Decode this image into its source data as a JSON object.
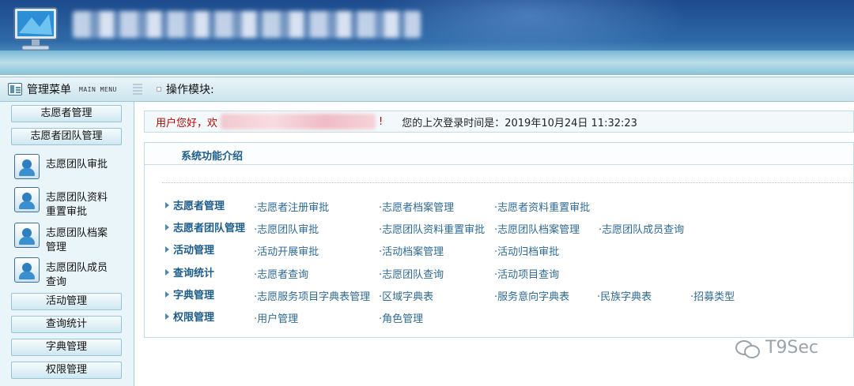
{
  "nav": {
    "menu_label": "管理菜单",
    "menu_sub": "MAIN MENU",
    "ops_label": "操作模块:"
  },
  "sidebar": {
    "categories": [
      "志愿者管理",
      "志愿者团队管理",
      "活动管理",
      "查询统计",
      "字典管理",
      "权限管理"
    ],
    "sub_items": [
      "志愿团队审批",
      "志愿团队资料重置审批",
      "志愿团队档案管理",
      "志愿团队成员查询"
    ]
  },
  "greeting": {
    "text": "用户您好，欢",
    "bang": "!",
    "last_login": "您的上次登录时间是：2019年10月24日 11:32:23"
  },
  "panel": {
    "title": "系统功能介绍",
    "rows": [
      {
        "head": "志愿者管理",
        "links": [
          "·志愿者注册审批",
          "·志愿者档案管理",
          "·志愿者资料重置审批"
        ]
      },
      {
        "head": "志愿者团队管理",
        "links": [
          "·志愿团队审批",
          "·志愿团队资料重置审批",
          "·志愿团队档案管理",
          "·志愿团队成员查询"
        ]
      },
      {
        "head": "活动管理",
        "links": [
          "·活动开展审批",
          "·活动档案管理",
          "·活动归档审批"
        ]
      },
      {
        "head": "查询统计",
        "links": [
          "·志愿者查询",
          "·志愿团队查询",
          "·活动项目查询"
        ]
      },
      {
        "head": "字典管理",
        "links": [
          "·志愿服务项目字典表管理",
          "·区域字典表",
          "·服务意向字典表",
          "·民族字典表",
          "·招募类型"
        ]
      },
      {
        "head": "权限管理",
        "links": [
          "·用户管理",
          "·角色管理"
        ]
      }
    ]
  },
  "watermark": {
    "text": "T9Sec"
  },
  "icons": {
    "menu": "menu-icon",
    "sub": "volunteer-user-icon",
    "row": "triangle-right-icon",
    "wechat": "wechat-icon"
  }
}
